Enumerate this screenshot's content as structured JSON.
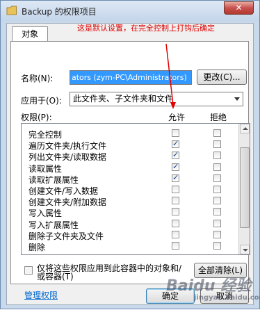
{
  "window": {
    "title": "Backup 的权限项目",
    "close_label": "✕"
  },
  "tab_label": "对象",
  "name_label": "名称(N):",
  "name_value": "ators (zym-PC\\Administrators)",
  "change_button": "更改(C)...",
  "apply_label": "应用于(O):",
  "apply_value": "此文件夹、子文件夹和文件",
  "perm_label": "权限(P):",
  "allow_header": "允许",
  "deny_header": "拒绝",
  "permissions": [
    {
      "name": "完全控制",
      "allow": false,
      "deny": false
    },
    {
      "name": "遍历文件夹/执行文件",
      "allow": true,
      "deny": false
    },
    {
      "name": "列出文件夹/读取数据",
      "allow": true,
      "deny": false
    },
    {
      "name": "读取属性",
      "allow": true,
      "deny": false
    },
    {
      "name": "读取扩展属性",
      "allow": true,
      "deny": false
    },
    {
      "name": "创建文件/写入数据",
      "allow": false,
      "deny": false
    },
    {
      "name": "创建文件夹/附加数据",
      "allow": false,
      "deny": false
    },
    {
      "name": "写入属性",
      "allow": false,
      "deny": false
    },
    {
      "name": "写入扩展属性",
      "allow": false,
      "deny": false
    },
    {
      "name": "删除子文件夹及文件",
      "allow": false,
      "deny": false
    },
    {
      "name": "删除",
      "allow": false,
      "deny": false
    }
  ],
  "apply_only_text": "仅将这些权限应用到此容器中的对象和/或容器(T)",
  "clear_all_button": "全部清除(L)",
  "manage_link": "管理权限",
  "ok_button": "确定",
  "cancel_button": "取消",
  "annotation": "这是默认设置，在完全控制上打钩后确定",
  "watermark": {
    "main": "Baidu 经验",
    "sub": "jingyan.baidu.com"
  },
  "colors": {
    "selection": "#3399ff",
    "annotation": "#e00000",
    "link": "#0066cc"
  }
}
